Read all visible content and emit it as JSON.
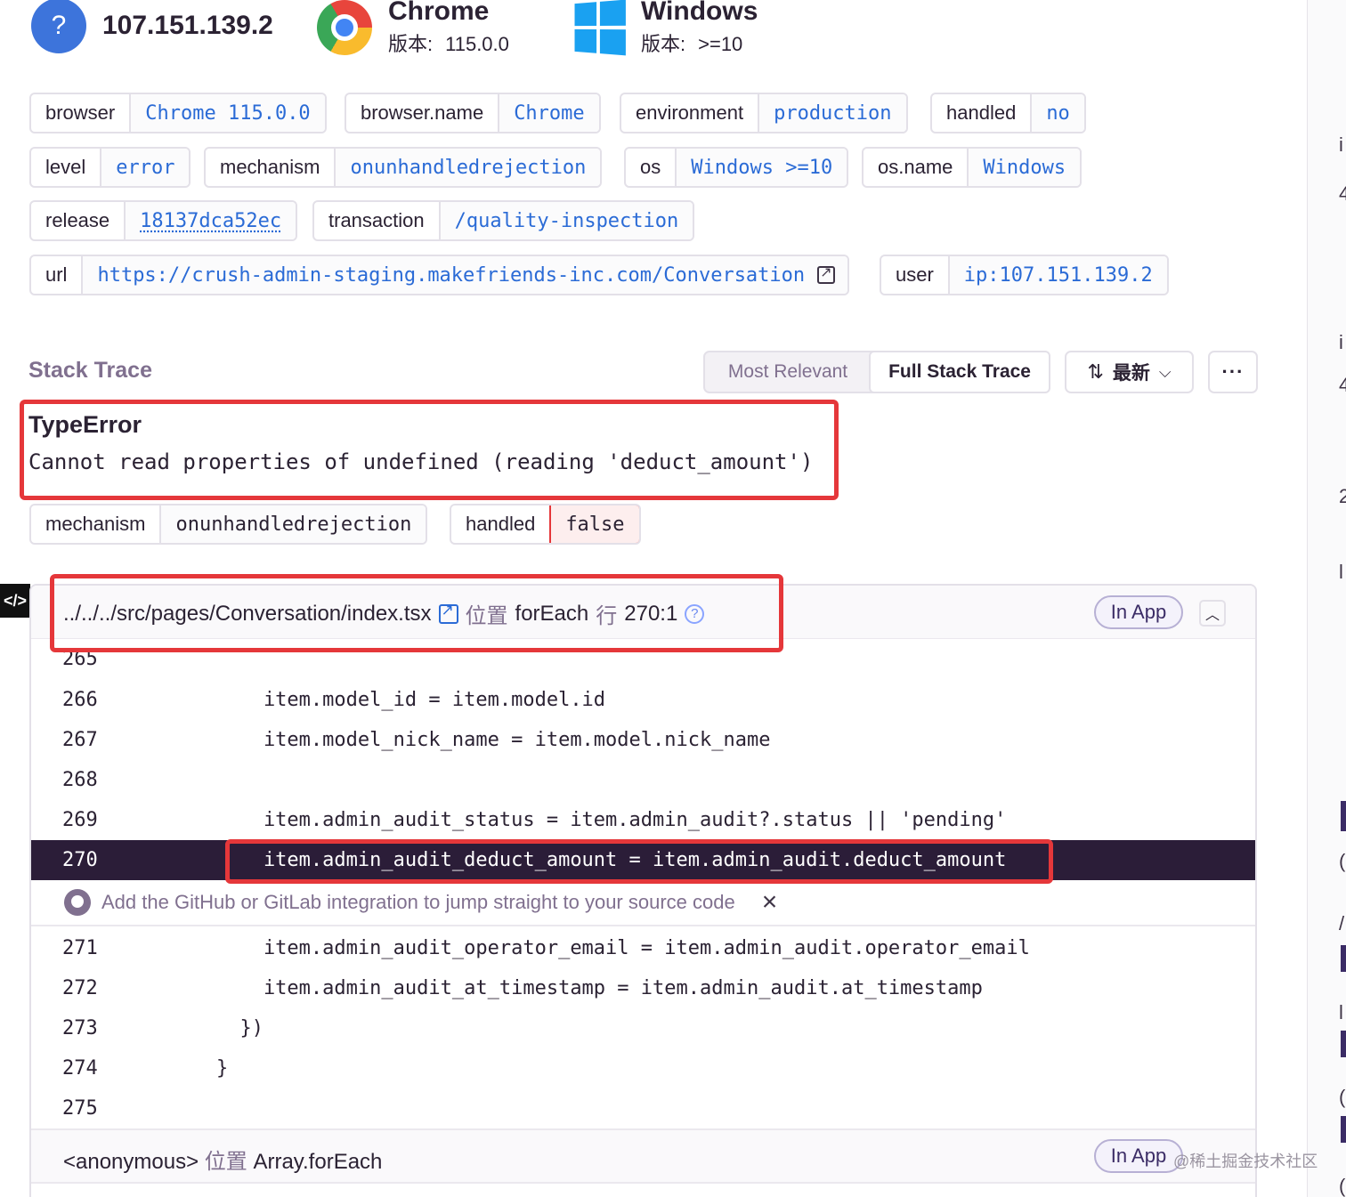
{
  "summary": {
    "ip": {
      "icon": "question-icon",
      "glyph": "?",
      "text": "107.151.139.2"
    },
    "browser": {
      "name": "Chrome",
      "version_label": "版本:",
      "version": "115.0.0"
    },
    "os": {
      "name": "Windows",
      "version_label": "版本:",
      "version": ">=10"
    }
  },
  "tags": [
    {
      "key": "browser",
      "value": "Chrome 115.0.0"
    },
    {
      "key": "browser.name",
      "value": "Chrome"
    },
    {
      "key": "environment",
      "value": "production"
    },
    {
      "key": "handled",
      "value": "no"
    },
    {
      "key": "level",
      "value": "error"
    },
    {
      "key": "mechanism",
      "value": "onunhandledrejection"
    },
    {
      "key": "os",
      "value": "Windows >=10"
    },
    {
      "key": "os.name",
      "value": "Windows"
    },
    {
      "key": "release",
      "value": "18137dca52ec"
    },
    {
      "key": "transaction",
      "value": "/quality-inspection"
    },
    {
      "key": "url",
      "value": "https://crush-admin-staging.makefriends-inc.com/Conversation"
    },
    {
      "key": "user",
      "value": "ip:107.151.139.2"
    }
  ],
  "stack_trace": {
    "title": "Stack Trace",
    "view_options": [
      "Most Relevant",
      "Full Stack Trace"
    ],
    "active_view": "Full Stack Trace",
    "sort_label": "最新",
    "more_label": "···"
  },
  "error": {
    "type": "TypeError",
    "message": "Cannot read properties of undefined (reading 'deduct_amount')"
  },
  "error_tags": [
    {
      "key": "mechanism",
      "value": "onunhandledrejection"
    },
    {
      "key": "handled",
      "value": "false"
    }
  ],
  "code_badge": "</>",
  "frame": {
    "file": "../../../src/pages/Conversation/index.tsx",
    "at_label": "位置",
    "function": "forEach",
    "line_label": "行",
    "position": "270:1",
    "badge": "In App"
  },
  "code_lines": [
    {
      "num": "265",
      "code": ""
    },
    {
      "num": "266",
      "code": "            item.model_id = item.model.id"
    },
    {
      "num": "267",
      "code": "            item.model_nick_name = item.model.nick_name"
    },
    {
      "num": "268",
      "code": ""
    },
    {
      "num": "269",
      "code": "            item.admin_audit_status = item.admin_audit?.status || 'pending'"
    },
    {
      "num": "270",
      "code": "            item.admin_audit_deduct_amount = item.admin_audit.deduct_amount",
      "active": true
    },
    {
      "num": "271",
      "code": "            item.admin_audit_operator_email = item.admin_audit.operator_email"
    },
    {
      "num": "272",
      "code": "            item.admin_audit_at_timestamp = item.admin_audit.at_timestamp"
    },
    {
      "num": "273",
      "code": "          })"
    },
    {
      "num": "274",
      "code": "        }"
    },
    {
      "num": "275",
      "code": ""
    }
  ],
  "integration_notice": "Add the GitHub or GitLab integration to jump straight to your source code",
  "frame2": {
    "function": "<anonymous>",
    "at_label": "位置",
    "target": "Array.forEach",
    "badge": "In App"
  },
  "watermark": "@稀土掘金技术社区",
  "edge_chars": [
    "i",
    "4",
    "i",
    "4",
    "2",
    "l",
    "(",
    "/",
    "l",
    "(",
    "l",
    "("
  ]
}
